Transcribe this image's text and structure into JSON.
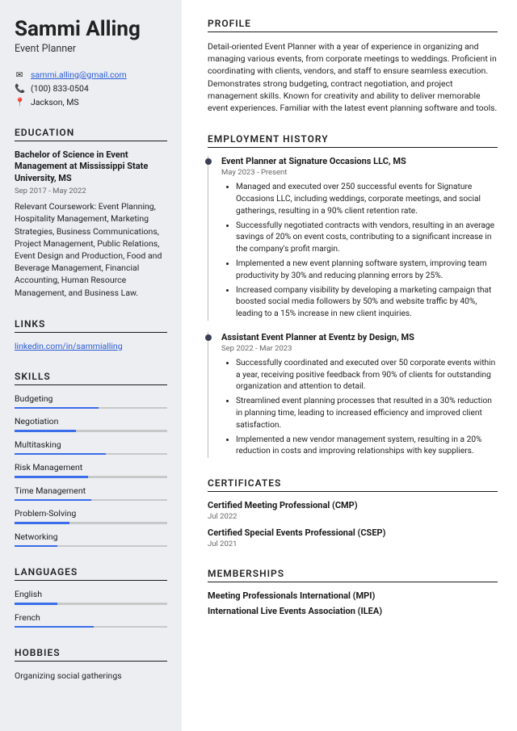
{
  "name": "Sammi Alling",
  "role": "Event Planner",
  "contact": {
    "email": "sammi.alling@gmail.com",
    "phone": "(100) 833-0504",
    "location": "Jackson, MS"
  },
  "sections": {
    "education": "EDUCATION",
    "links": "LINKS",
    "skills": "SKILLS",
    "languages": "LANGUAGES",
    "hobbies": "HOBBIES",
    "profile": "PROFILE",
    "employment": "EMPLOYMENT HISTORY",
    "certificates": "CERTIFICATES",
    "memberships": "MEMBERSHIPS"
  },
  "education": {
    "degree": "Bachelor of Science in Event Management at Mississippi State University, MS",
    "dates": "Sep 2017 - May 2022",
    "body": "Relevant Coursework: Event Planning, Hospitality Management, Marketing Strategies, Business Communications, Project Management, Public Relations, Event Design and Production, Food and Beverage Management, Financial Accounting, Human Resource Management, and Business Law."
  },
  "links": [
    {
      "label": "linkedin.com/in/sammialling"
    }
  ],
  "skills": [
    {
      "name": "Budgeting",
      "pct": 55
    },
    {
      "name": "Negotiation",
      "pct": 40
    },
    {
      "name": "Multitasking",
      "pct": 60
    },
    {
      "name": "Risk Management",
      "pct": 48
    },
    {
      "name": "Time Management",
      "pct": 50
    },
    {
      "name": "Problem-Solving",
      "pct": 36
    },
    {
      "name": "Networking",
      "pct": 28
    }
  ],
  "languages": [
    {
      "name": "English",
      "pct": 28
    },
    {
      "name": "French",
      "pct": 52
    }
  ],
  "hobbies": [
    "Organizing social gatherings"
  ],
  "profile": "Detail-oriented Event Planner with a year of experience in organizing and managing various events, from corporate meetings to weddings. Proficient in coordinating with clients, vendors, and staff to ensure seamless execution. Demonstrates strong budgeting, contract negotiation, and project management skills. Known for creativity and ability to deliver memorable event experiences. Familiar with the latest event planning software and tools.",
  "employment": [
    {
      "title": "Event Planner at Signature Occasions LLC, MS",
      "dates": "May 2023 - Present",
      "bullets": [
        "Managed and executed over 250 successful events for Signature Occasions LLC, including weddings, corporate meetings, and social gatherings, resulting in a 90% client retention rate.",
        "Successfully negotiated contracts with vendors, resulting in an average savings of 20% on event costs, contributing to a significant increase in the company's profit margin.",
        "Implemented a new event planning software system, improving team productivity by 30% and reducing planning errors by 25%.",
        "Increased company visibility by developing a marketing campaign that boosted social media followers by 50% and website traffic by 40%, leading to a 15% increase in new client inquiries."
      ]
    },
    {
      "title": "Assistant Event Planner at Eventz by Design, MS",
      "dates": "Sep 2022 - Mar 2023",
      "bullets": [
        "Successfully coordinated and executed over 50 corporate events within a year, receiving positive feedback from 90% of clients for outstanding organization and attention to detail.",
        "Streamlined event planning processes that resulted in a 30% reduction in planning time, leading to increased efficiency and improved client satisfaction.",
        "Implemented a new vendor management system, resulting in a 20% reduction in costs and improving relationships with key suppliers."
      ]
    }
  ],
  "certificates": [
    {
      "name": "Certified Meeting Professional (CMP)",
      "date": "Jul 2022"
    },
    {
      "name": "Certified Special Events Professional (CSEP)",
      "date": "Jul 2021"
    }
  ],
  "memberships": [
    "Meeting Professionals International (MPI)",
    "International Live Events Association (ILEA)"
  ]
}
